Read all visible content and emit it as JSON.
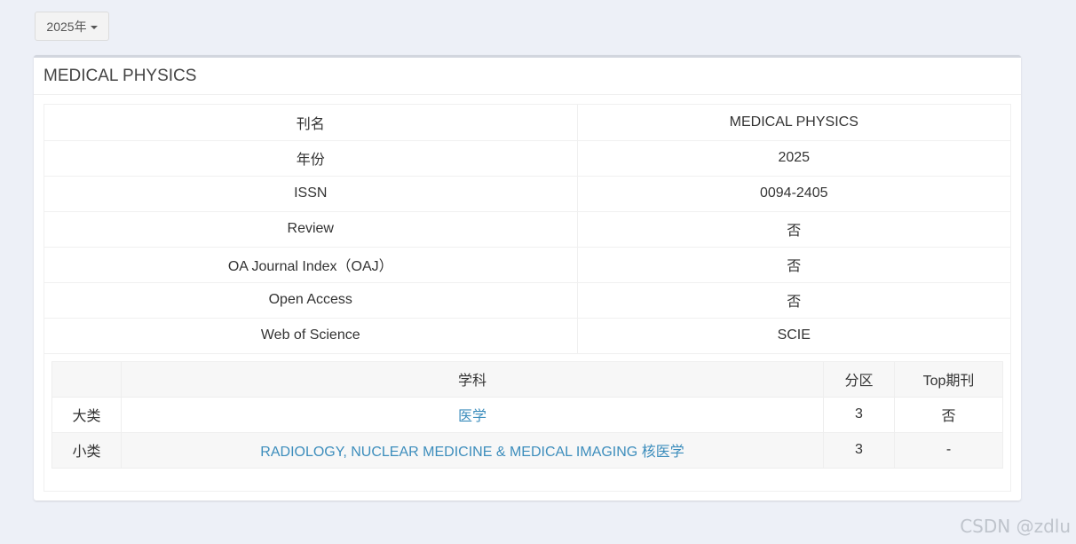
{
  "year_dropdown": {
    "label": "2025年"
  },
  "panel": {
    "title": "MEDICAL PHYSICS",
    "info_rows": [
      {
        "key": "刊名",
        "value": "MEDICAL PHYSICS"
      },
      {
        "key": "年份",
        "value": "2025"
      },
      {
        "key": "ISSN",
        "value": "0094-2405"
      },
      {
        "key": "Review",
        "value": "否"
      },
      {
        "key": "OA Journal Index（OAJ）",
        "value": "否"
      },
      {
        "key": "Open Access",
        "value": "否"
      },
      {
        "key": "Web of Science",
        "value": "SCIE"
      }
    ],
    "subject_table": {
      "headers": [
        "",
        "学科",
        "分区",
        "Top期刊"
      ],
      "rows": [
        {
          "level": "大类",
          "subject": "医学",
          "zone": "3",
          "top": "否"
        },
        {
          "level": "小类",
          "subject": "RADIOLOGY, NUCLEAR MEDICINE & MEDICAL IMAGING 核医学",
          "zone": "3",
          "top": "-"
        }
      ]
    }
  },
  "watermark": "CSDN @zdlu",
  "colors": {
    "background": "#edf0f7",
    "link": "#3c8dbc",
    "panel_border": "#d2d6de"
  }
}
